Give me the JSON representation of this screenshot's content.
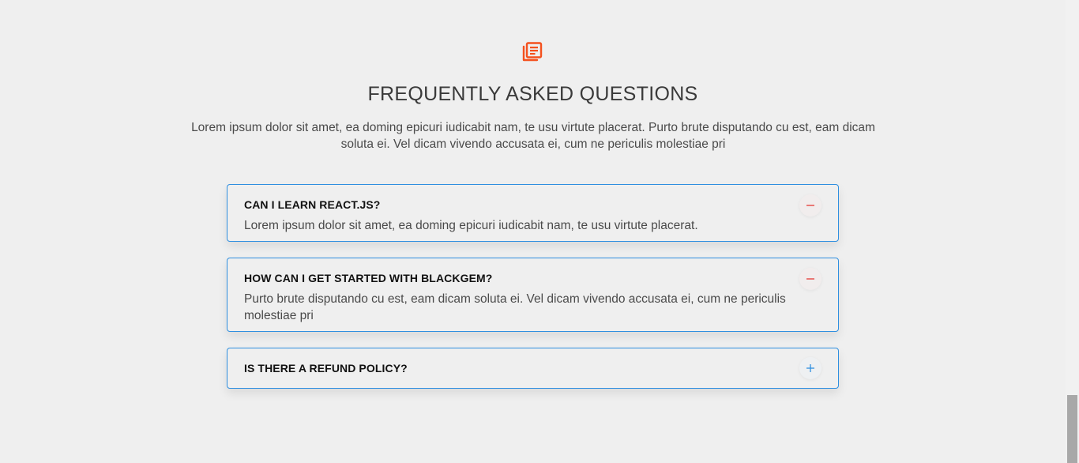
{
  "section": {
    "icon": "newspaper-icon",
    "title": "FREQUENTLY ASKED QUESTIONS",
    "intro": "Lorem ipsum dolor sit amet, ea doming epicuri iudicabit nam, te usu virtute placerat. Purto brute disputando cu est, eam dicam soluta ei. Vel dicam vivendo accusata ei, cum ne periculis molestiae pri"
  },
  "faq": [
    {
      "question": "CAN I LEARN REACT.JS?",
      "answer": "Lorem ipsum dolor sit amet, ea doming epicuri iudicabit nam, te usu virtute placerat.",
      "expanded": true,
      "toggle_icon": "minus-icon"
    },
    {
      "question": "HOW CAN I GET STARTED WITH BLACKGEM?",
      "answer": "Purto brute disputando cu est, eam dicam soluta ei. Vel dicam vivendo accusata ei, cum ne periculis molestiae pri",
      "expanded": true,
      "toggle_icon": "minus-icon"
    },
    {
      "question": "IS THERE A REFUND POLICY?",
      "answer": "",
      "expanded": false,
      "toggle_icon": "plus-icon"
    }
  ],
  "colors": {
    "accent": "#f4511e",
    "border": "#2f8fe0",
    "minus": "#e53935",
    "plus": "#2f8fe0",
    "background": "#efefef"
  },
  "scroll_position": 0.85
}
